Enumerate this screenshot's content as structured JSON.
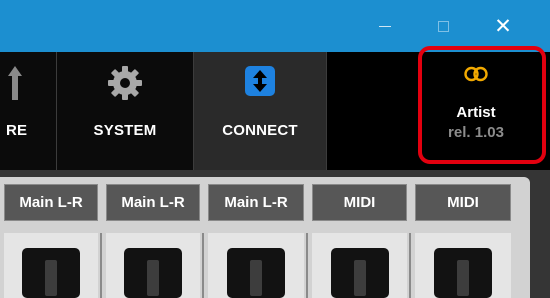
{
  "window": {
    "minimize_label": "—",
    "close_label": "✕"
  },
  "nav": {
    "tabs": [
      {
        "label": "RE",
        "icon": "arrow-up-icon"
      },
      {
        "label": "SYSTEM",
        "icon": "gear-icon"
      },
      {
        "label": "CONNECT",
        "icon": "up-down-arrows-icon"
      }
    ],
    "artist": {
      "name": "Artist",
      "release": "rel. 1.03",
      "icon": "linked-rings-icon",
      "icon_color": "#f2a900"
    },
    "highlight_color": "#e3000f",
    "accent_color": "#1e82e0"
  },
  "mixer": {
    "channels": [
      {
        "label": "Main L-R"
      },
      {
        "label": "Main L-R"
      },
      {
        "label": "Main L-R"
      },
      {
        "label": "MIDI"
      },
      {
        "label": "MIDI"
      }
    ]
  }
}
